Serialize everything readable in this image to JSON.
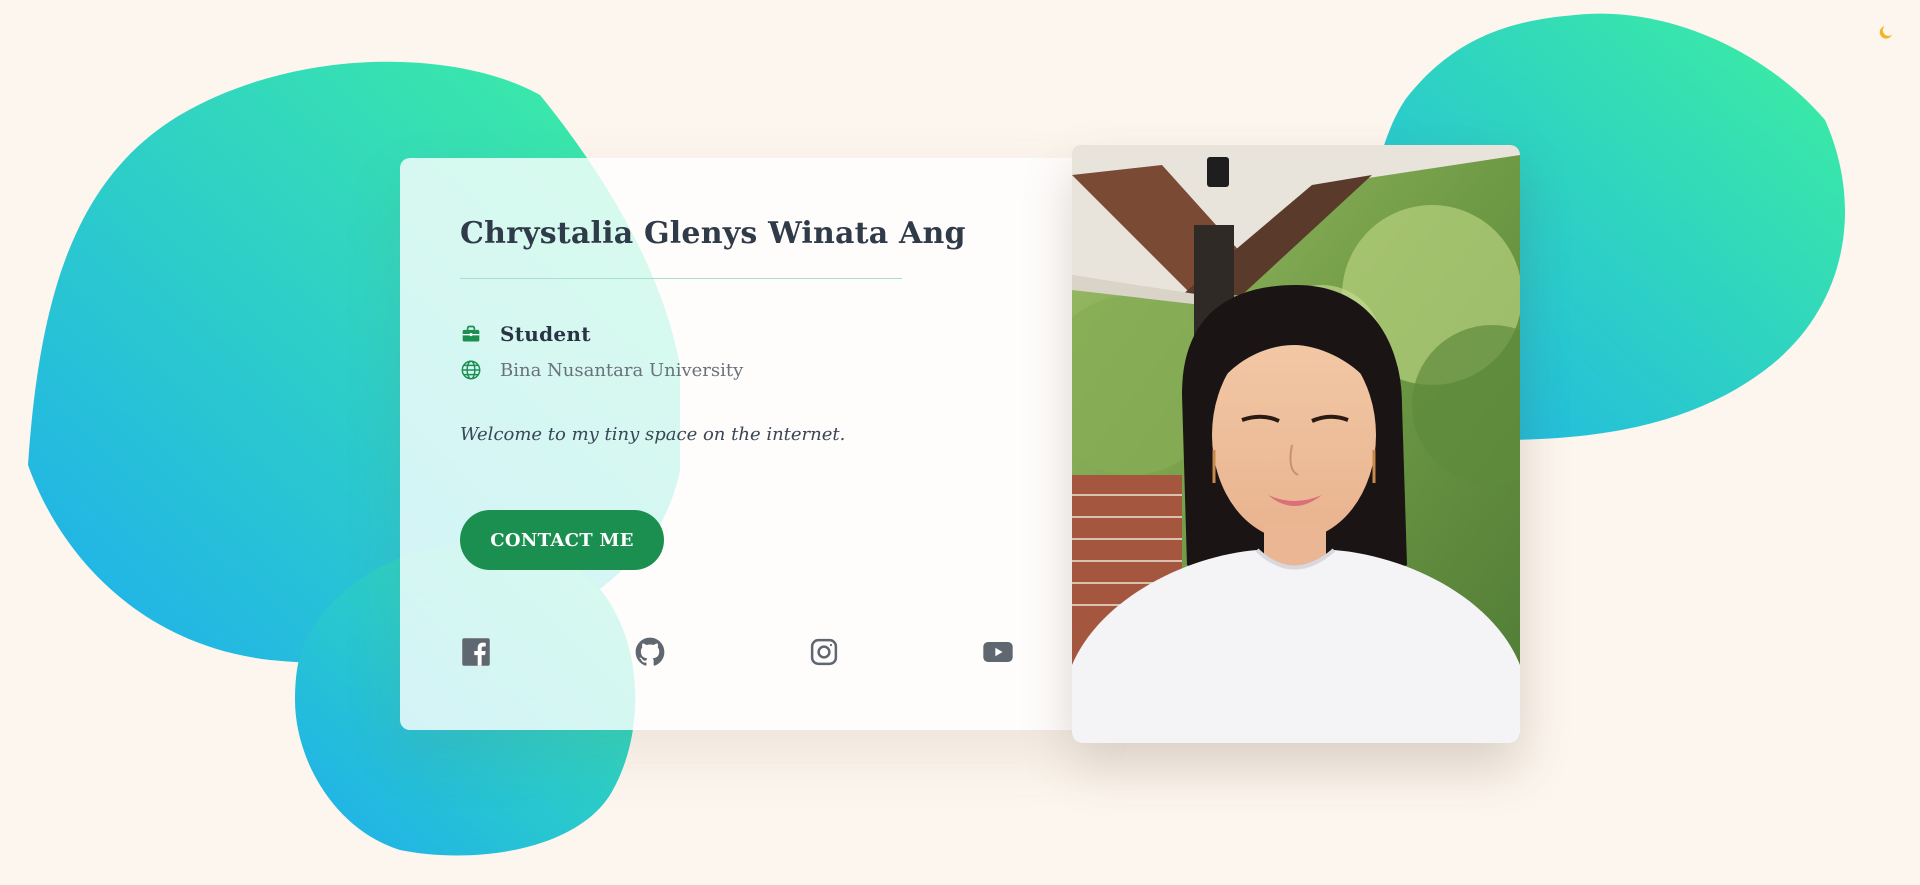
{
  "profile": {
    "name": "Chrystalia Glenys Winata Ang",
    "role": "Student",
    "school": "Bina Nusantara University",
    "tagline": "Welcome to my tiny space on the internet."
  },
  "actions": {
    "contact_label": "CONTACT ME"
  },
  "social": [
    {
      "icon": "facebook-icon"
    },
    {
      "icon": "github-icon"
    },
    {
      "icon": "instagram-icon"
    },
    {
      "icon": "youtube-icon"
    }
  ],
  "icons": {
    "role": "briefcase-icon",
    "school": "globe-icon",
    "theme_toggle": "moon-icon"
  },
  "colors": {
    "background": "#fdf6ee",
    "accent_green": "#1b8f50",
    "blob_gradient_start": "#1eb0ef",
    "blob_gradient_end": "#3ef0a0",
    "name_text": "#303b4a",
    "social_icon": "#5f6770"
  }
}
